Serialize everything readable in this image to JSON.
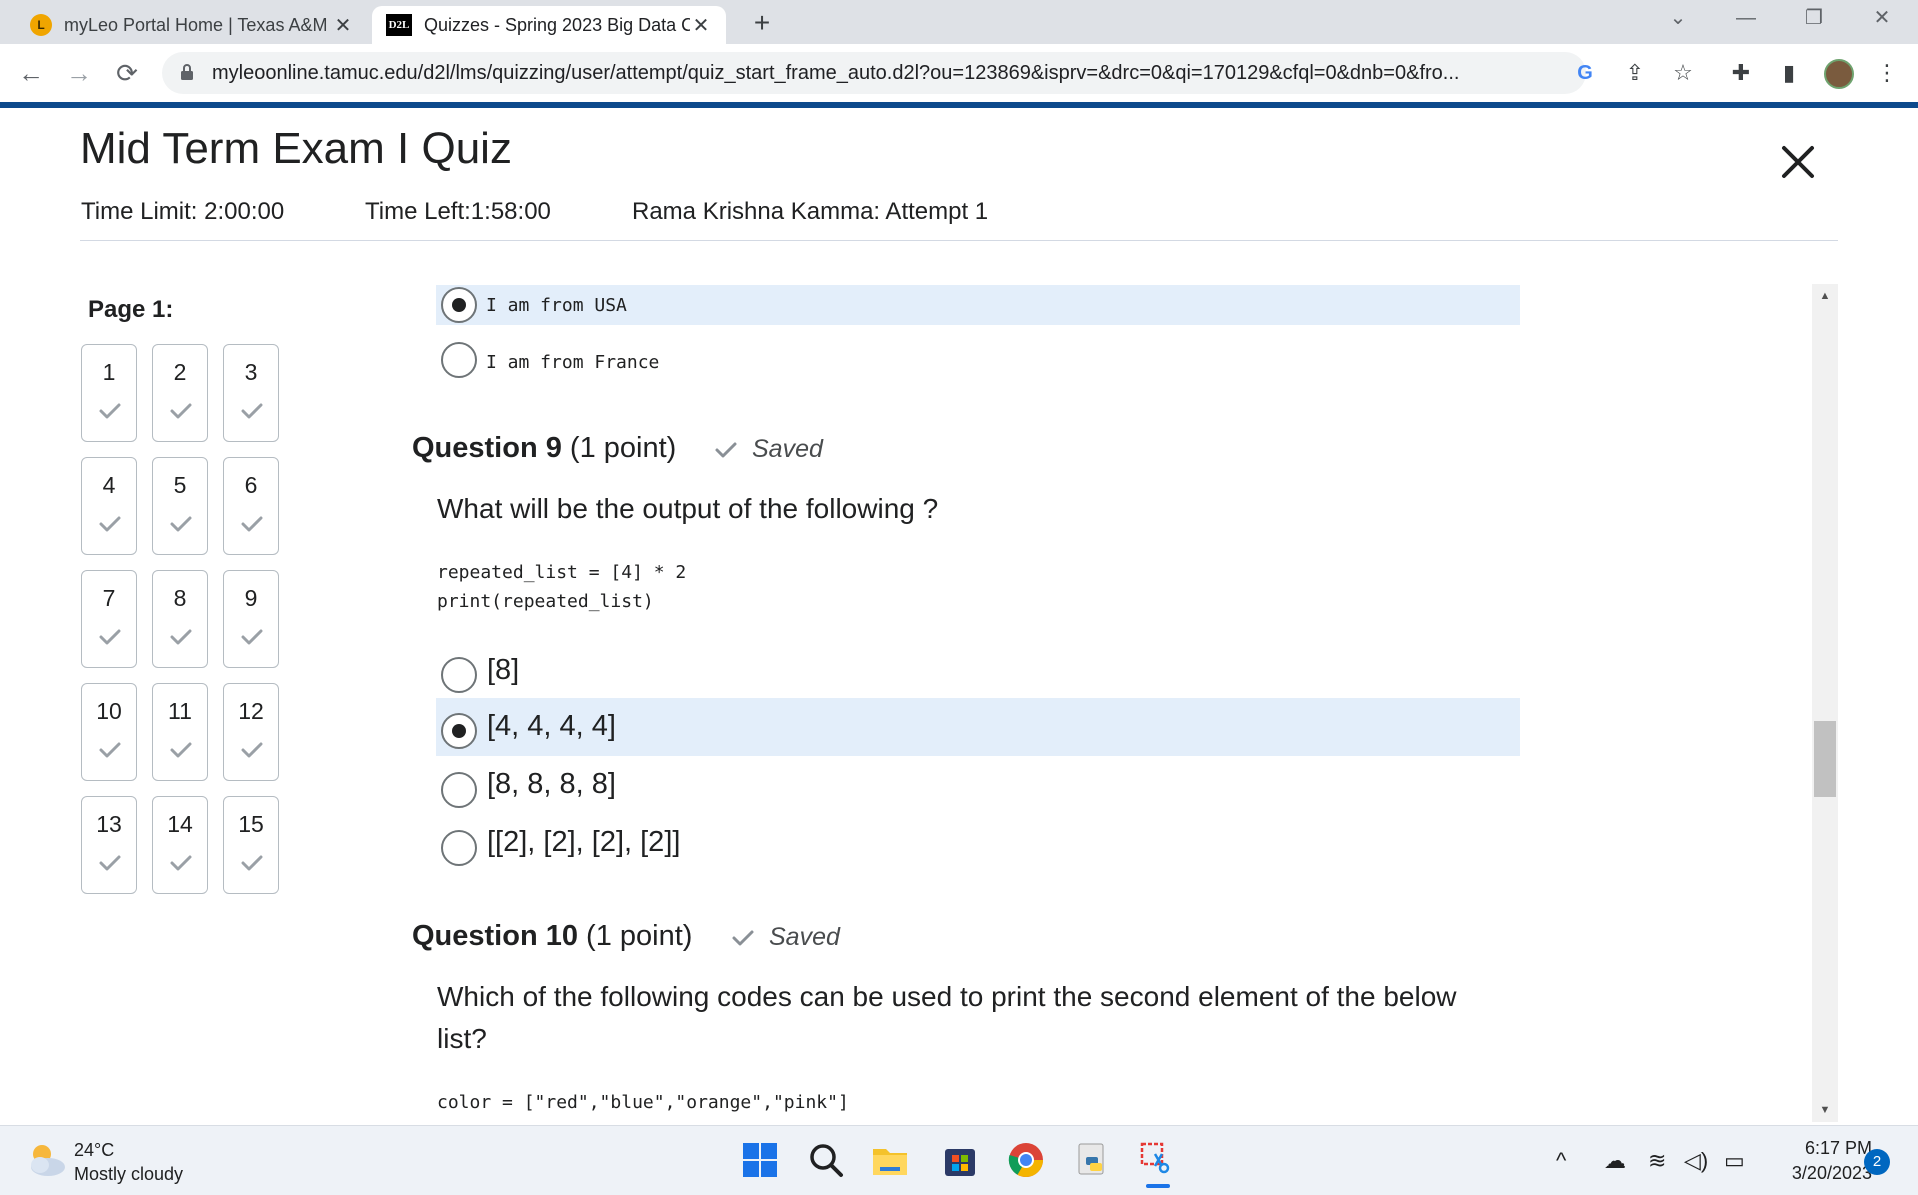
{
  "browser": {
    "tabs": [
      {
        "title": "myLeo Portal Home | Texas A&M",
        "favicon": "leo-logo-icon"
      },
      {
        "title": "Quizzes - Spring 2023 Big Data C",
        "favicon": "d2l-logo-icon",
        "favicon_text": "D2L"
      }
    ],
    "url": "myleoonline.tamuc.edu/d2l/lms/quizzing/user/attempt/quiz_start_frame_auto.d2l?ou=123869&isprv=&drc=0&qi=170129&cfql=0&dnb=0&fro...",
    "accent_color": "#0d4a8c"
  },
  "quiz": {
    "title": "Mid Term Exam I Quiz",
    "time_limit": "Time Limit: 2:00:00",
    "time_left": "Time Left:1:58:00",
    "attempt": "Rama Krishna Kamma: Attempt 1",
    "page_label": "Page 1:",
    "question_numbers": [
      "1",
      "2",
      "3",
      "4",
      "5",
      "6",
      "7",
      "8",
      "9",
      "10",
      "11",
      "12",
      "13",
      "14",
      "15"
    ],
    "prev_options": [
      {
        "text": "I am from USA",
        "selected": true
      },
      {
        "text": "I am from France",
        "selected": false
      }
    ],
    "q9": {
      "label": "Question 9",
      "points": " (1 point)",
      "status": "Saved",
      "text": "What will be the output of the following ?",
      "code_line1": "repeated_list = [4] * 2",
      "code_line2": "print(repeated_list)",
      "options": [
        {
          "text": "[8]",
          "selected": false
        },
        {
          "text": "[4, 4, 4, 4]",
          "selected": true
        },
        {
          "text": "[8, 8, 8, 8]",
          "selected": false
        },
        {
          "text": "[[2], [2], [2], [2]]",
          "selected": false
        }
      ]
    },
    "q10": {
      "label": "Question 10",
      "points": " (1 point)",
      "status": "Saved",
      "text_line1": "Which of the following codes can be used to print the second element of the below",
      "text_line2": "list?",
      "code_line1": "color = [\"red\",\"blue\",\"orange\",\"pink\"]"
    }
  },
  "taskbar": {
    "temperature": "24°C",
    "weather": "Mostly cloudy",
    "time": "6:17 PM",
    "date": "3/20/2023",
    "notifications": "2"
  }
}
